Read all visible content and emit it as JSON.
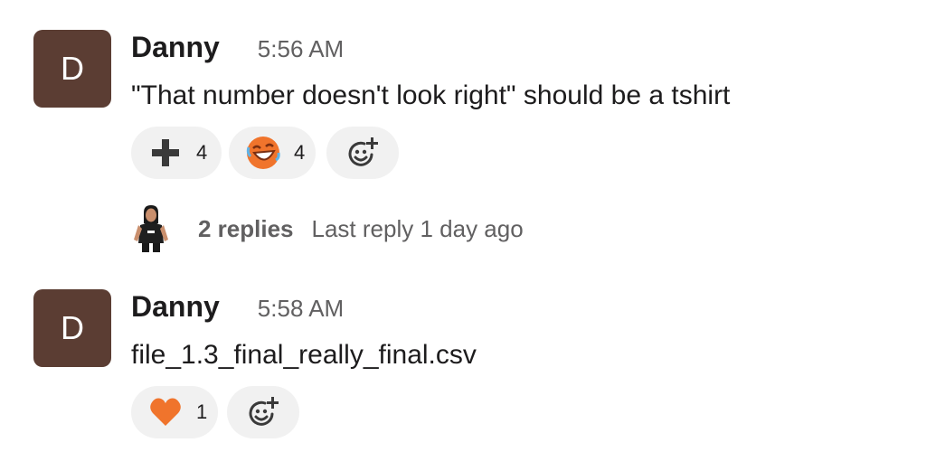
{
  "messages": [
    {
      "avatar_letter": "D",
      "author": "Danny",
      "time": "5:56 AM",
      "text": "\"That number doesn't look right\" should be a tshirt",
      "reactions": [
        {
          "emoji": "heavy-plus-sign-icon",
          "count": "4"
        },
        {
          "emoji": "rolling-on-floor-laughing-icon",
          "count": "4"
        }
      ],
      "thread": {
        "replies": "2 replies",
        "last_reply": "Last reply 1 day ago"
      }
    },
    {
      "avatar_letter": "D",
      "author": "Danny",
      "time": "5:58 AM",
      "text": "file_1.3_final_really_final.csv",
      "reactions": [
        {
          "emoji": "orange-heart-icon",
          "count": "1"
        }
      ]
    }
  ],
  "colors": {
    "avatar_bg": "#5b3d33",
    "reaction_bg": "#f1f1f1",
    "muted_text": "#616061",
    "primary_text": "#1d1c1d",
    "emoji_orange": "#f0742c"
  }
}
